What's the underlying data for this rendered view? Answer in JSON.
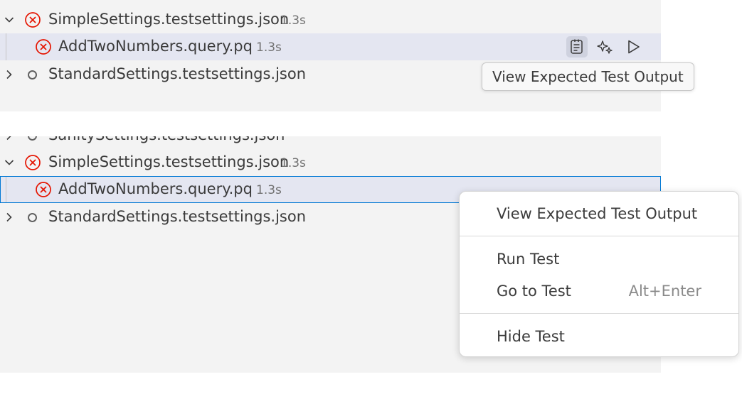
{
  "top_panel": {
    "rows": [
      {
        "label": "SimpleSettings.testsettings.json",
        "duration": "1.3s",
        "state": "failed",
        "expanded": true
      },
      {
        "label": "AddTwoNumbers.query.pq",
        "duration": "1.3s",
        "state": "failed",
        "selected": true
      },
      {
        "label": "StandardSettings.testsettings.json",
        "state": "not-run",
        "expanded": false
      }
    ],
    "actions": [
      "view-expected-output-icon",
      "sparkle-icon",
      "run-icon"
    ],
    "tooltip": "View Expected Test Output"
  },
  "bottom_panel": {
    "rows": [
      {
        "label": "SanitySettings.testsettings.json",
        "state": "not-run",
        "expanded": false,
        "partially_visible": true
      },
      {
        "label": "SimpleSettings.testsettings.json",
        "duration": "1.3s",
        "state": "failed",
        "expanded": true
      },
      {
        "label": "AddTwoNumbers.query.pq",
        "duration": "1.3s",
        "state": "failed",
        "selected": true
      },
      {
        "label": "StandardSettings.testsettings.json",
        "state": "not-run",
        "expanded": false
      }
    ]
  },
  "context_menu": {
    "items": [
      {
        "label": "View Expected Test Output",
        "shortcut": ""
      },
      {
        "label": "Run Test",
        "shortcut": ""
      },
      {
        "label": "Go to Test",
        "shortcut": "Alt+Enter"
      },
      {
        "label": "Hide Test",
        "shortcut": ""
      }
    ]
  },
  "colors": {
    "error": "#e51400",
    "selection_bg": "#e4e6f1",
    "focus_border": "#0078d4",
    "panel_bg": "#f3f3f3"
  }
}
